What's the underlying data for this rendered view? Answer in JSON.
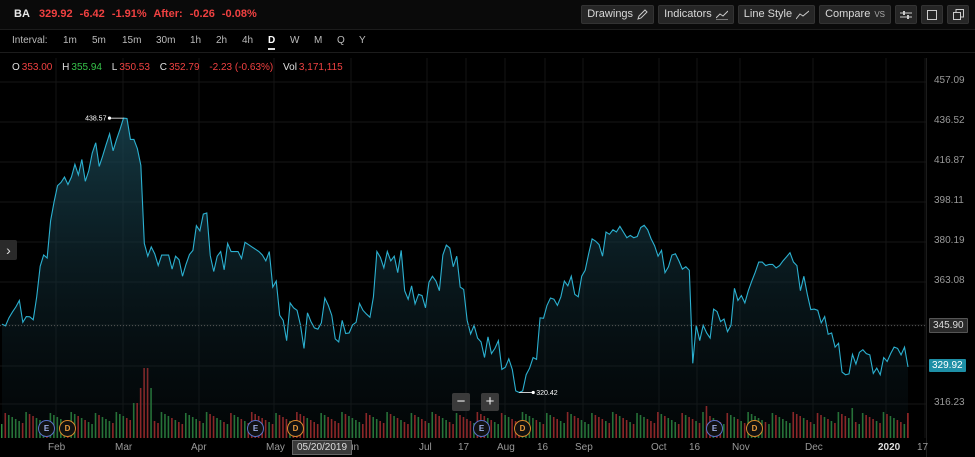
{
  "quote": {
    "symbol": "BA",
    "last": "329.92",
    "change": "-6.42",
    "change_pct": "-1.91%",
    "after_label": "After:",
    "after_change": "-0.26",
    "after_pct": "-0.08%"
  },
  "toolbar": {
    "drawings": "Drawings",
    "indicators": "Indicators",
    "line_style": "Line Style",
    "compare": "Compare",
    "compare_suffix": "VS"
  },
  "intervals": {
    "label": "Interval:",
    "items": [
      "1m",
      "5m",
      "15m",
      "30m",
      "1h",
      "2h",
      "4h",
      "D",
      "W",
      "M",
      "Q",
      "Y"
    ],
    "active": "D"
  },
  "ohlc": {
    "o_label": "O",
    "o": "353.00",
    "h_label": "H",
    "h": "355.94",
    "l_label": "L",
    "l": "350.53",
    "c_label": "C",
    "c": "352.79",
    "c_change": "-2.23 (-0.63%)",
    "vol_label": "Vol",
    "vol": "3,171,115"
  },
  "events": [
    {
      "type": "E",
      "label": "E"
    },
    {
      "type": "D",
      "label": "D"
    },
    {
      "type": "E",
      "label": "E"
    },
    {
      "type": "D",
      "label": "D"
    },
    {
      "type": "E",
      "label": "E"
    },
    {
      "type": "D",
      "label": "D"
    },
    {
      "type": "E",
      "label": "E"
    },
    {
      "type": "D",
      "label": "D"
    }
  ],
  "zoom": {
    "minus": "−",
    "plus": "+"
  },
  "cursor_date": "05/20/2019",
  "colors": {
    "line": "#2bb0d0",
    "up_vol": "#2e8b3e",
    "down_vol": "#b02a2a",
    "last_tag": "#1e8fa6"
  },
  "chart_data": {
    "type": "area",
    "series": [
      {
        "name": "BA",
        "values": [
          346.5,
          345.8,
          349.0,
          351.3,
          353.4,
          356.0,
          347.2,
          349.5,
          349.4,
          348.2,
          357.5,
          370.2,
          375.0,
          373.7,
          390.0,
          398.5,
          406.0,
          407.5,
          410.0,
          406.5,
          410.0,
          416.0,
          411.0,
          418.3,
          408.0,
          413.0,
          421.4,
          426.4,
          415.0,
          420.0,
          425.5,
          430.8,
          422.5,
          428.0,
          433.0,
          438.57,
          438.4,
          428.0,
          428.0,
          423.5,
          415.5,
          380.0,
          374.5,
          378.5,
          375.5,
          370.5,
          375.0,
          375.0,
          375.0,
          369.0,
          374.5,
          373.0,
          366.0,
          371.0,
          375.2,
          377.0,
          387.8,
          385.5,
          393.0,
          393.5,
          374.7,
          368.0,
          374.5,
          376.5,
          368.7,
          380.0,
          376.5,
          376.5,
          376.5,
          373.5,
          380.5,
          379.5,
          378.5,
          377.5,
          376.5,
          375.0,
          372.5,
          376.5,
          361.5,
          364.0,
          350.0,
          348.0,
          340.0,
          355.0,
          353.0,
          352.0,
          346.0,
          337.0,
          351.0,
          347.5,
          345.0,
          344.5,
          347.0,
          357.0,
          354.0,
          350.0,
          340.7,
          339.5,
          348.0,
          342.8,
          343.0,
          346.2,
          347.2,
          354.8,
          352.0,
          350.5,
          349.2,
          357.5,
          376.5,
          374.0,
          369.5,
          376.5,
          372.5,
          374.5,
          367.5,
          377.0,
          360.0,
          356.5,
          362.0,
          354.6,
          358.5,
          358.0,
          353.0,
          363.5,
          366.0,
          364.0,
          360.0,
          375.0,
          379.3,
          378.0,
          370.0,
          374.5,
          361.5,
          360.5,
          348.0,
          342.6,
          346.0,
          341.0,
          339.5,
          333.5,
          341.5,
          335.0,
          337.0,
          340.0,
          329.0,
          329.8,
          333.0,
          329.0,
          321.0,
          320.42,
          321.0,
          327.0,
          329.5,
          333.5,
          332.8,
          349.0,
          348.8,
          354.0,
          357.0,
          356.5,
          354.0,
          357.5,
          364.0,
          362.0,
          366.0,
          358.5,
          357.5,
          366.0,
          368.5,
          375.5,
          382.0,
          381.0,
          379.5,
          374.5,
          385.0,
          384.0,
          386.0,
          385.0,
          387.5,
          385.0,
          382.5,
          383.5,
          382.5,
          383.0,
          387.0,
          388.0,
          386.0,
          382.0,
          379.0,
          374.5,
          377.0,
          367.5,
          370.0,
          375.0,
          375.5,
          372.5,
          369.0,
          370.0,
          368.5,
          331.3,
          346.0,
          340.0,
          346.0,
          343.0,
          341.0,
          352.5,
          351.5,
          347.5,
          348.5,
          343.5,
          346.0,
          361.0,
          356.0,
          358.0,
          355.0,
          360.0,
          364.0,
          367.7,
          372.0,
          372.0,
          370.5,
          371.0,
          371.0,
          369.5,
          370.5,
          372.5,
          374.2,
          376.0,
          372.0,
          370.5,
          360.0,
          366.0,
          358.5,
          352.3,
          352.5,
          352.0,
          347.0,
          349.5,
          342.5,
          343.0,
          337.5,
          339.0,
          328.0,
          327.0,
          327.3,
          334.7,
          331.0,
          335.5,
          336.5,
          335.0,
          334.5,
          327.5,
          329.5,
          327.0,
          333.5,
          332.0,
          335.0,
          337.5,
          337.0,
          334.5,
          337.5,
          329.92
        ]
      }
    ],
    "x_tick_labels": [
      "Feb",
      "Mar",
      "Apr",
      "May",
      "Jun",
      "Jul",
      "17",
      "Aug",
      "16",
      "Sep",
      "Oct",
      "16",
      "Nov",
      "Dec",
      "2020",
      "17"
    ],
    "y_tick_labels": [
      "457.09",
      "436.52",
      "416.87",
      "398.11",
      "380.19",
      "363.08",
      "345.90",
      "329.92",
      "316.23"
    ],
    "ylim": [
      300,
      460
    ],
    "log_scale": true,
    "reference_line": 345.9,
    "last_value": 329.92,
    "high_marker": 438.57,
    "low_marker": 320.42,
    "grid": true
  }
}
